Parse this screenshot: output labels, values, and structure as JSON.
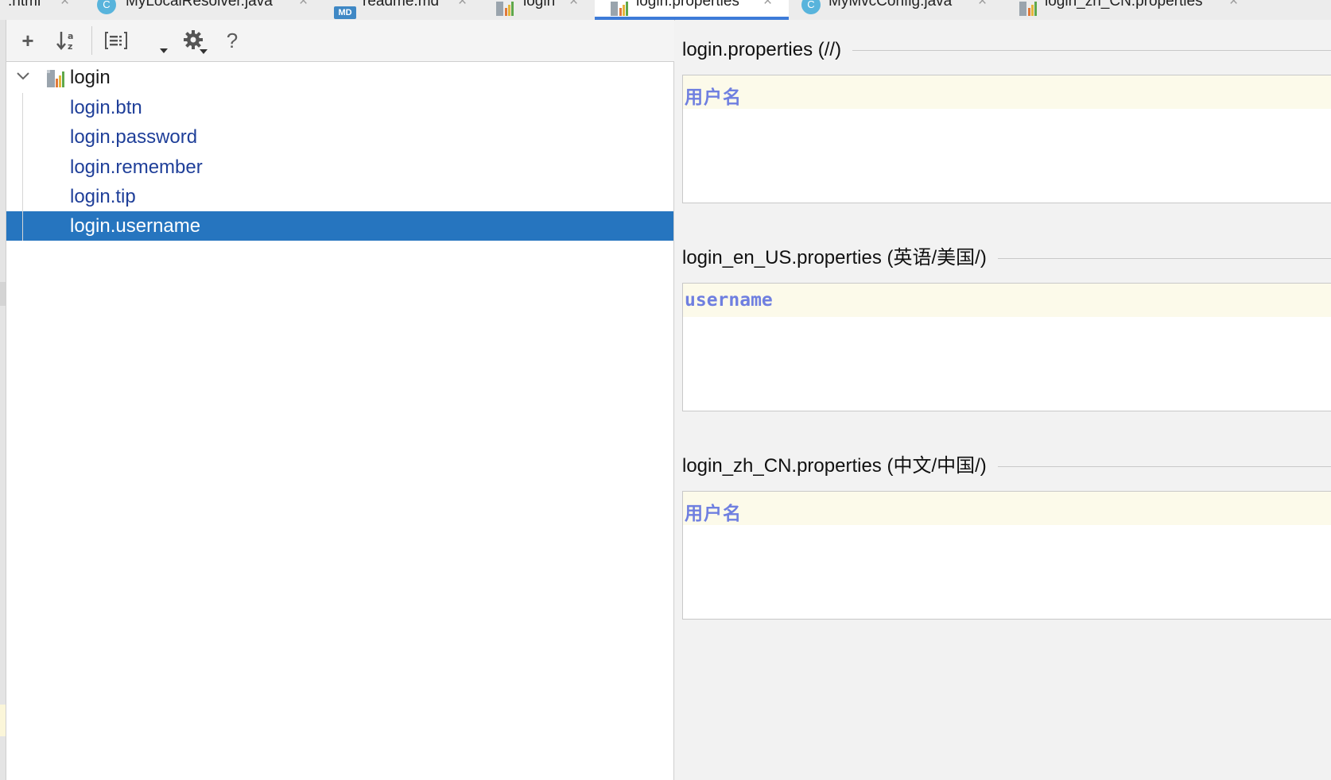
{
  "tabs": [
    {
      "label": ".html",
      "icon": "html-file-icon",
      "active": false
    },
    {
      "label": "MyLocalResolver.java",
      "icon": "java-class-icon",
      "icon_text": "C",
      "active": false
    },
    {
      "label": "readme.md",
      "icon": "markdown-file-icon",
      "icon_text": "MD",
      "active": false
    },
    {
      "label": "login",
      "icon": "resource-bundle-icon",
      "active": false
    },
    {
      "label": "login.properties",
      "icon": "resource-bundle-icon",
      "active": true
    },
    {
      "label": "MyMvcConfig.java",
      "icon": "java-class-icon",
      "icon_text": "C",
      "active": false
    },
    {
      "label": "login_zh_CN.properties",
      "icon": "resource-bundle-icon",
      "active": false
    }
  ],
  "tab_close_glyph": "×",
  "toolbar": {
    "add_glyph": "+",
    "help_glyph": "?",
    "items": [
      "add-property-icon",
      "sort-alphabetically-icon",
      "group-by-prefix-icon",
      "settings-gear-icon",
      "help-icon"
    ]
  },
  "tree": {
    "root": "login",
    "keys": [
      "login.btn",
      "login.password",
      "login.remember",
      "login.tip",
      "login.username"
    ],
    "selected": "login.username"
  },
  "editors": [
    {
      "title": "login.properties (//)",
      "value": "用户名"
    },
    {
      "title": "login_en_US.properties (英语/美国/)",
      "value": "username"
    },
    {
      "title": "login_zh_CN.properties (中文/中国/)",
      "value": "用户名"
    }
  ],
  "colors": {
    "selection": "#2675bf",
    "key_text": "#1f3f99",
    "value_text": "#6f7fe0",
    "value_line_highlight": "#fcfaea",
    "active_tab_underline": "#3d7bd8"
  }
}
